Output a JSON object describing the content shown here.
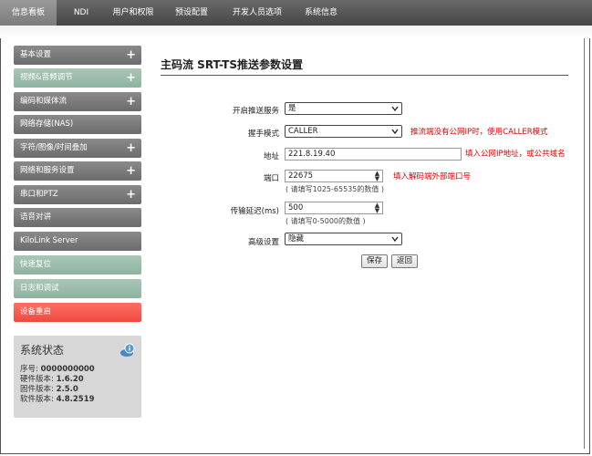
{
  "nav": {
    "tabs": [
      "信息看板",
      "NDI",
      "用户和权限",
      "预设配置",
      "开发人员选项",
      "系统信息"
    ],
    "active_index": 0
  },
  "sidebar": {
    "items": [
      {
        "label": "基本设置",
        "plus": "+"
      },
      {
        "label": "视频&音频调节",
        "plus": "+"
      },
      {
        "label": "编码和媒体流",
        "plus": "+"
      },
      {
        "label": "网络存储(NAS)",
        "plus": ""
      },
      {
        "label": "字符/图像/时间叠加",
        "plus": "+"
      },
      {
        "label": "网络和服务设置",
        "plus": "+"
      },
      {
        "label": "串口和PTZ",
        "plus": "+"
      },
      {
        "label": "语音对讲",
        "plus": ""
      },
      {
        "label": "KiloLink Server",
        "plus": ""
      },
      {
        "label": "快速复位",
        "plus": ""
      },
      {
        "label": "日志和调试",
        "plus": ""
      },
      {
        "label": "设备重启",
        "plus": ""
      }
    ]
  },
  "status": {
    "title": "系统状态",
    "serial_label": "序号:",
    "serial": "0000000000",
    "hw_label": "硬件版本:",
    "hw": "1.6.20",
    "fw_label": "固件版本:",
    "fw": "2.5.0",
    "sw_label": "软件版本:",
    "sw": "4.8.2519"
  },
  "main": {
    "title": "主码流 SRT-TS推送参数设置",
    "form": {
      "enable_label": "开启推送服务",
      "enable_value": "是",
      "mode_label": "握手模式",
      "mode_value": "CALLER",
      "mode_note": "推流端没有公网IP时，使用CALLER模式",
      "address_label": "地址",
      "address_value": "221.8.19.40",
      "address_note": "填入公网IP地址，或公共域名",
      "port_label": "端口",
      "port_value": "22675",
      "port_hint": "( 请填写1025-65535的数值 )",
      "port_note": "填入解码端外部端口号",
      "latency_label": "传输延迟(ms)",
      "latency_value": "500",
      "latency_hint": "( 请填写0-5000的数值 )",
      "advanced_label": "高级设置",
      "advanced_value": "隐藏"
    },
    "buttons": {
      "save": "保存",
      "back": "返回"
    }
  },
  "colors": {
    "nav_bg": "#454545",
    "sidebar_gray": "#7a7a7a",
    "sidebar_green": "#9dbcad",
    "sidebar_red": "#f05a50",
    "note_red": "#e00000"
  }
}
